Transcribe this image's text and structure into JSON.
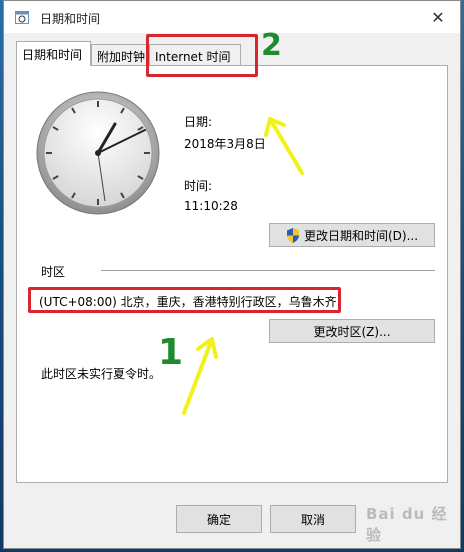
{
  "window": {
    "title": "日期和时间"
  },
  "tabs": [
    {
      "label": "日期和时间",
      "active": true
    },
    {
      "label": "附加时钟",
      "active": false
    },
    {
      "label": "Internet 时间",
      "active": false
    }
  ],
  "date": {
    "label": "日期:",
    "value": "2018年3月8日"
  },
  "time": {
    "label": "时间:",
    "value": "11:10:28"
  },
  "change_datetime_button": "更改日期和时间(D)...",
  "timezone": {
    "section_label": "时区",
    "value": "(UTC+08:00) 北京，重庆，香港特别行政区，乌鲁木齐",
    "change_button": "更改时区(Z)...",
    "dst_note": "此时区未实行夏令时。"
  },
  "annotations": {
    "step1": "1",
    "step2": "2"
  },
  "buttons": {
    "ok": "确定",
    "cancel": "取消"
  },
  "watermark": "Bai du 经验",
  "colors": {
    "highlight": "#d9262e",
    "arrow": "#f2f21a",
    "marker": "#1f8a2e"
  }
}
